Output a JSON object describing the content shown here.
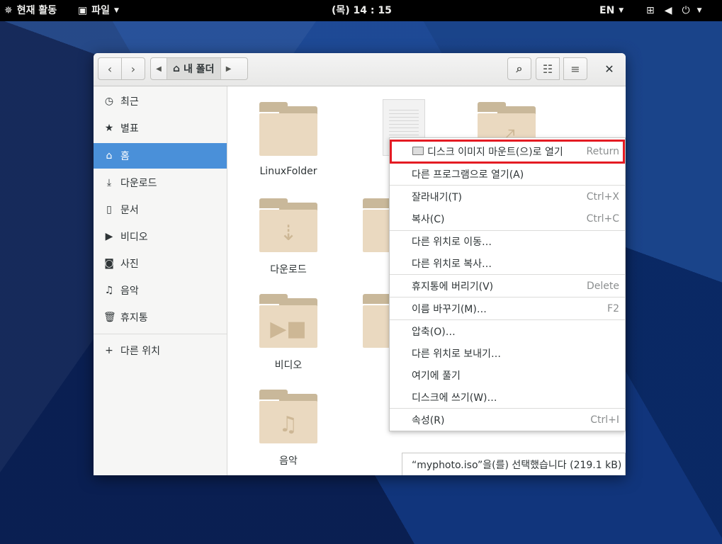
{
  "topbar": {
    "activities": "현재 활동",
    "app_menu": "파일",
    "clock": "(목) 14 : 15",
    "language": "EN"
  },
  "headerbar": {
    "path_home": "내 폴더"
  },
  "sidebar": {
    "items": [
      {
        "label": "최근",
        "icon": "clock-icon"
      },
      {
        "label": "별표",
        "icon": "star-icon"
      },
      {
        "label": "홈",
        "icon": "home-icon"
      },
      {
        "label": "다운로드",
        "icon": "download-icon"
      },
      {
        "label": "문서",
        "icon": "document-icon"
      },
      {
        "label": "비디오",
        "icon": "video-icon"
      },
      {
        "label": "사진",
        "icon": "camera-icon"
      },
      {
        "label": "음악",
        "icon": "music-icon"
      },
      {
        "label": "휴지통",
        "icon": "trash-icon"
      }
    ],
    "other_locations": "다른 위치",
    "active_index": 2
  },
  "files": [
    {
      "name": "LinuxFolder",
      "type": "folder"
    },
    {
      "name": "myp",
      "type": "iso",
      "selected": true
    },
    {
      "name": "",
      "type": "folder-shared"
    },
    {
      "name": "다운로드",
      "type": "folder-download"
    },
    {
      "name": "비디오",
      "type": "folder-video"
    },
    {
      "name": "음악",
      "type": "folder-music"
    }
  ],
  "context_menu": {
    "items": [
      {
        "label": "디스크 이미지 마운트(으)로 열기",
        "accel": "Return"
      },
      {
        "label": "다른 프로그램으로 열기(A)",
        "accel": ""
      },
      {
        "label": "잘라내기(T)",
        "accel": "Ctrl+X"
      },
      {
        "label": "복사(C)",
        "accel": "Ctrl+C"
      },
      {
        "label": "다른 위치로 이동…",
        "accel": ""
      },
      {
        "label": "다른 위치로 복사…",
        "accel": ""
      },
      {
        "label": "휴지통에 버리기(V)",
        "accel": "Delete"
      },
      {
        "label": "이름 바꾸기(M)…",
        "accel": "F2"
      },
      {
        "label": "압축(O)…",
        "accel": ""
      },
      {
        "label": "다른 위치로 보내기…",
        "accel": ""
      },
      {
        "label": "여기에 풀기",
        "accel": ""
      },
      {
        "label": "디스크에 쓰기(W)…",
        "accel": ""
      },
      {
        "label": "속성(R)",
        "accel": "Ctrl+I"
      }
    ],
    "highlight_color": "#e41b23"
  },
  "status": {
    "text": "“myphoto.iso”을(를) 선택했습니다  (219.1 kB)"
  },
  "colors": {
    "accent": "#4a90d9",
    "folder": "#ead9c0"
  }
}
